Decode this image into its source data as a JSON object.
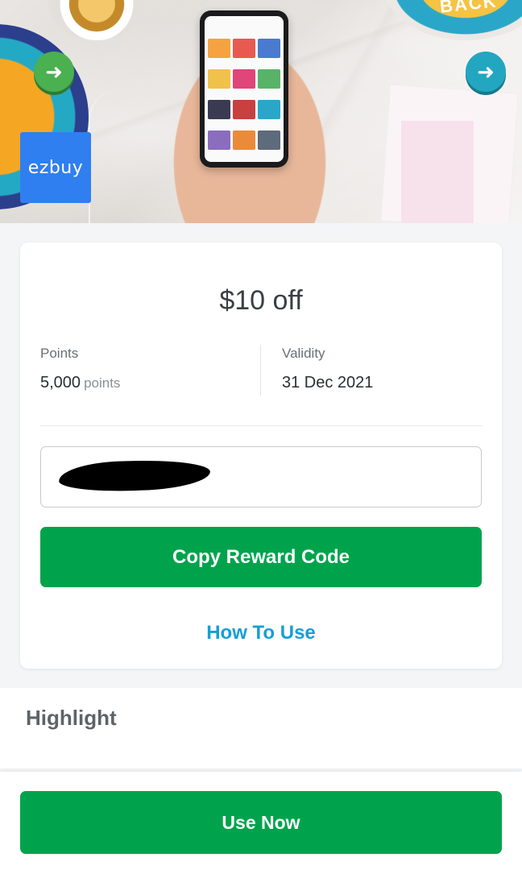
{
  "banner": {
    "brand_logo_text": "ezbuy",
    "decor_text": "BACK"
  },
  "voucher": {
    "offer": "$10 off",
    "points_label": "Points",
    "points_value": "5,000",
    "points_unit": "points",
    "validity_label": "Validity",
    "validity_value": "31 Dec 2021",
    "reward_code_redacted": true,
    "copy_button_label": "Copy Reward Code",
    "how_to_use_label": "How To Use"
  },
  "highlight": {
    "title": "Highlight"
  },
  "footer": {
    "use_now_label": "Use Now"
  },
  "colors": {
    "primary_green": "#00a34c",
    "link_blue": "#159fd6",
    "brand_blue": "#2f7ff0"
  }
}
